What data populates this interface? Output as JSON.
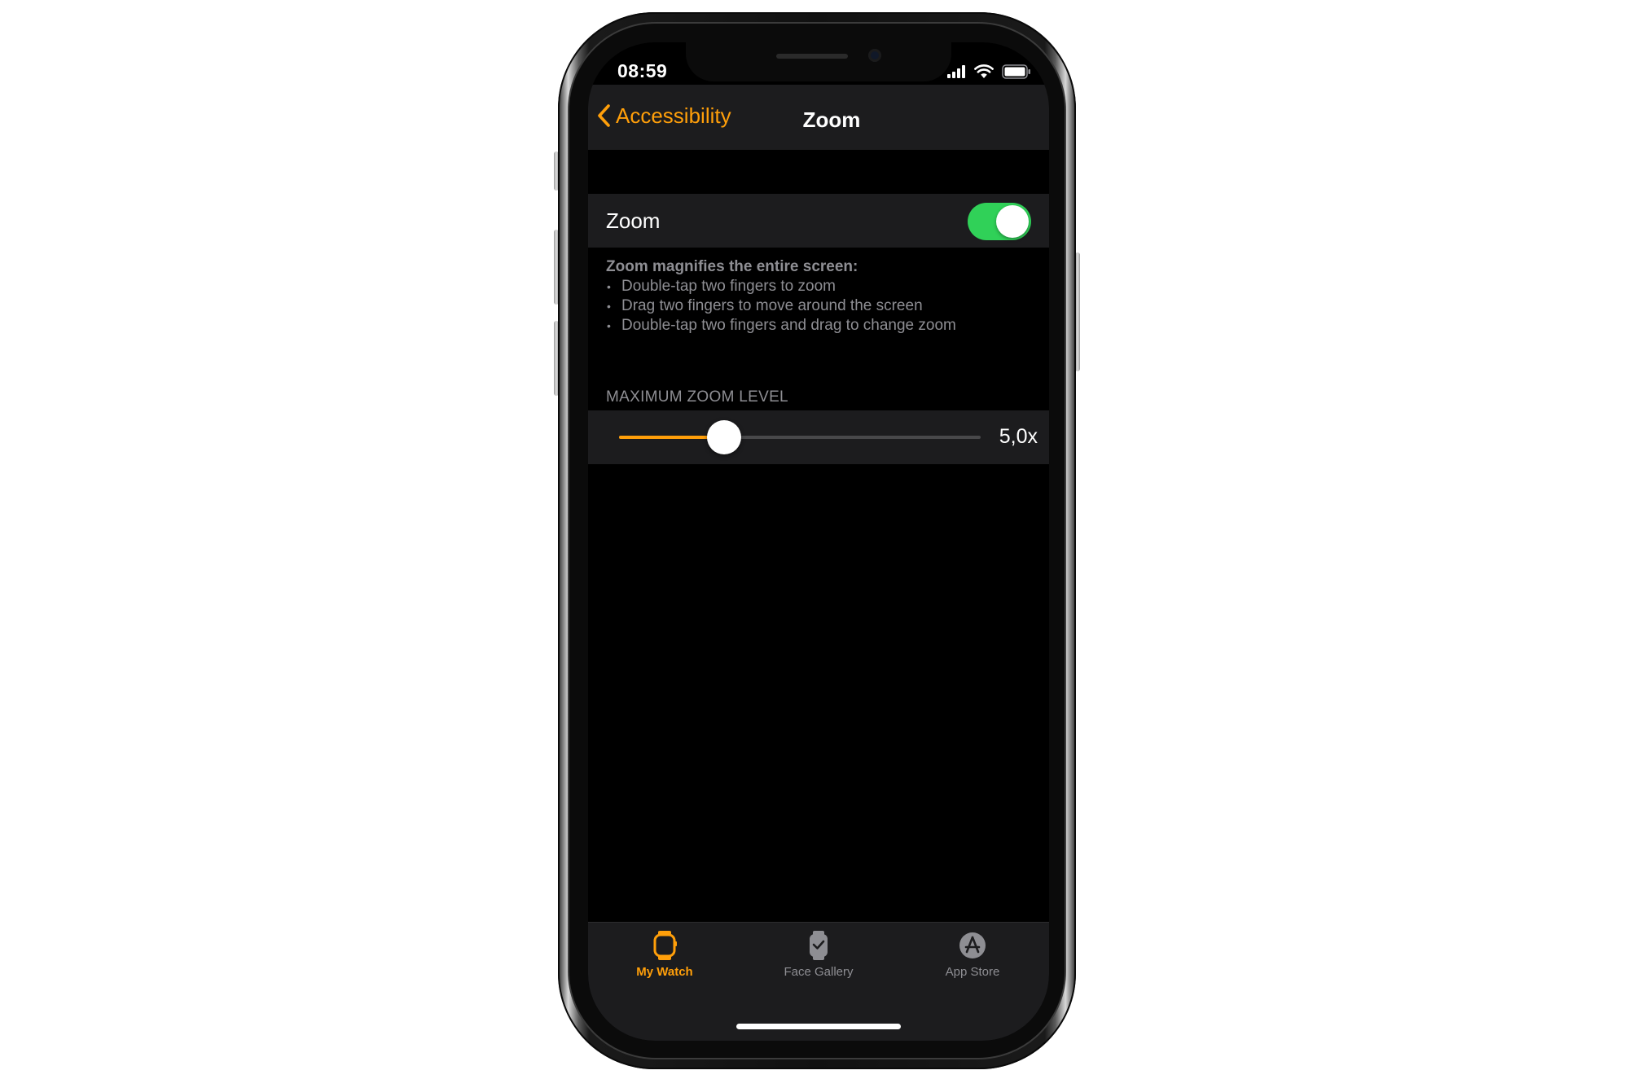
{
  "status_bar": {
    "time": "08:59",
    "icons": [
      "cellular-signal-icon",
      "wifi-icon",
      "battery-icon"
    ]
  },
  "nav": {
    "back_label": "Accessibility",
    "title": "Zoom"
  },
  "zoom_cell": {
    "label": "Zoom",
    "toggle_on": true
  },
  "description": {
    "title": "Zoom magnifies the entire screen:",
    "bullets": [
      "Double-tap two fingers to zoom",
      "Drag two fingers to move around the screen",
      "Double-tap two fingers and drag to change zoom"
    ]
  },
  "max_zoom": {
    "section_header": "MAXIMUM ZOOM LEVEL",
    "value_label": "5,0x",
    "slider_fraction": 0.29
  },
  "tab_bar": {
    "tabs": [
      {
        "label": "My Watch",
        "icon": "watch-icon",
        "active": true
      },
      {
        "label": "Face Gallery",
        "icon": "watch-face-icon",
        "active": false
      },
      {
        "label": "App Store",
        "icon": "app-store-icon",
        "active": false
      }
    ]
  },
  "colors": {
    "accent": "#ff9f0a",
    "toggle_on": "#30d158",
    "cell_background": "#1c1c1e",
    "screen_background": "#000000",
    "secondary_text": "#8e8e93"
  }
}
